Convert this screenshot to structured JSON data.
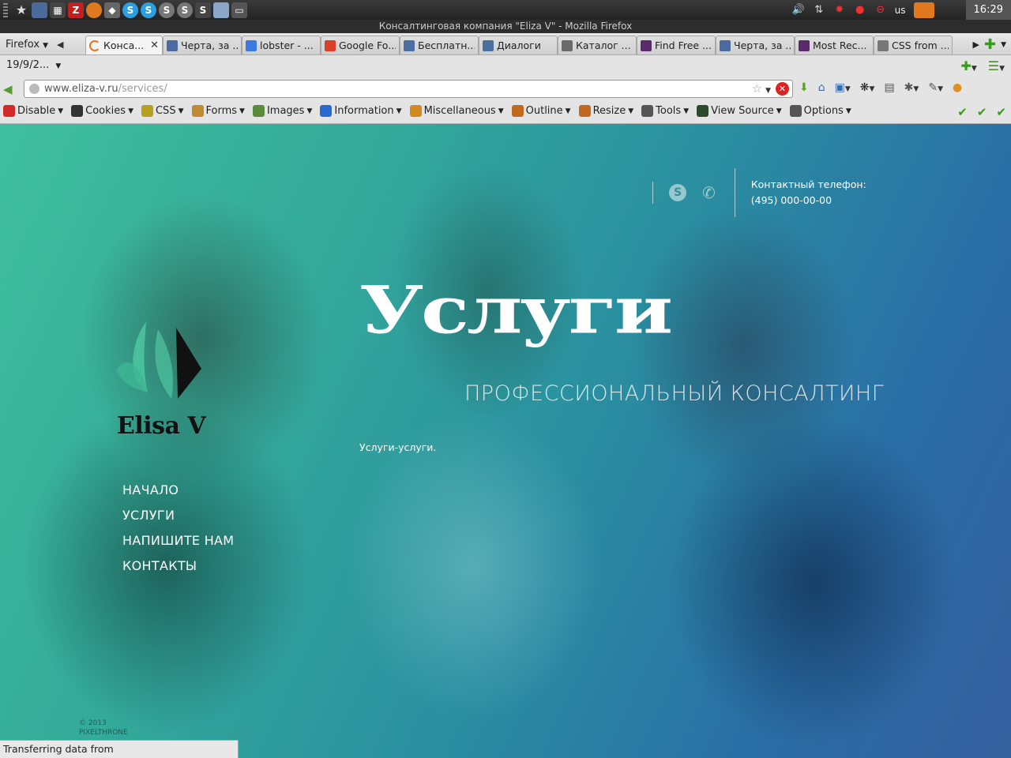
{
  "window": {
    "title": "Консалтинговая компания \"Eliza V\" - Mozilla Firefox"
  },
  "system": {
    "keyboard_layout": "us",
    "clock": "16:29"
  },
  "browser": {
    "menu_label": "Firefox",
    "tabs": [
      {
        "label": "Конса...",
        "icon": "loading-icon",
        "color": "#e0781e",
        "active": true
      },
      {
        "label": "Черта, за ...",
        "icon": "user-icon",
        "color": "#4a6aa0"
      },
      {
        "label": "lobster - ...",
        "icon": "google-icon",
        "color": "#3a7ae0"
      },
      {
        "label": "Google Fo...",
        "icon": "google-fonts-icon",
        "color": "#d8402a"
      },
      {
        "label": "Бесплатн...",
        "icon": "vk-icon",
        "color": "#4a6fa0"
      },
      {
        "label": "Диалоги",
        "icon": "vk-icon",
        "color": "#4a6fa0"
      },
      {
        "label": "Каталог ...",
        "icon": "catalog-icon",
        "color": "#6a6a6a"
      },
      {
        "label": "Find Free ...",
        "icon": "dafont-icon",
        "color": "#5a2a6a"
      },
      {
        "label": "Черта, за ...",
        "icon": "user-icon",
        "color": "#4a6aa0"
      },
      {
        "label": "Most Rec...",
        "icon": "dafont-icon",
        "color": "#5a2a6a"
      },
      {
        "label": "CSS from ...",
        "icon": "gear-icon",
        "color": "#777777"
      }
    ],
    "date_selector": "19/9/2...",
    "url": {
      "host": "www.eliza-v.ru",
      "path": "/services/"
    },
    "devbar": [
      {
        "label": "Disable",
        "icon": "disable-icon",
        "color": "#d22a2a"
      },
      {
        "label": "Cookies",
        "icon": "cookies-icon",
        "color": "#333333"
      },
      {
        "label": "CSS",
        "icon": "css-icon",
        "color": "#b8a020"
      },
      {
        "label": "Forms",
        "icon": "forms-icon",
        "color": "#c08a30"
      },
      {
        "label": "Images",
        "icon": "images-icon",
        "color": "#5a8a3a"
      },
      {
        "label": "Information",
        "icon": "information-icon",
        "color": "#2a6ad0"
      },
      {
        "label": "Miscellaneous",
        "icon": "miscellaneous-icon",
        "color": "#d08a20"
      },
      {
        "label": "Outline",
        "icon": "outline-icon",
        "color": "#c06a20"
      },
      {
        "label": "Resize",
        "icon": "resize-icon",
        "color": "#c06a20"
      },
      {
        "label": "Tools",
        "icon": "tools-icon",
        "color": "#555555"
      },
      {
        "label": "View Source",
        "icon": "view-source-icon",
        "color": "#2a4a2a"
      },
      {
        "label": "Options",
        "icon": "options-icon",
        "color": "#555555"
      }
    ],
    "status": "Transferring data from static.ak.facebook.com..."
  },
  "site": {
    "phone_label": "Контактный телефон:",
    "phone_number": "(495) 000-00-00",
    "hero_title": "Услуги",
    "hero_subtitle": "ПРОФЕССИОНАЛЬНЫЙ КОНСАЛТИНГ",
    "hero_note": "Услуги-услуги.",
    "logo_text": "Elisa V",
    "nav": [
      "НАЧАЛО",
      "УСЛУГИ",
      "НАПИШИТЕ НАМ",
      "КОНТАКТЫ"
    ],
    "copyright_line1": "© 2013",
    "copyright_line2": "PIXELTHRONE"
  },
  "colors": {
    "accent_teal": "#3fbf9c",
    "accent_blue": "#2a6ea6",
    "logo_green": "#4ec7a0"
  }
}
